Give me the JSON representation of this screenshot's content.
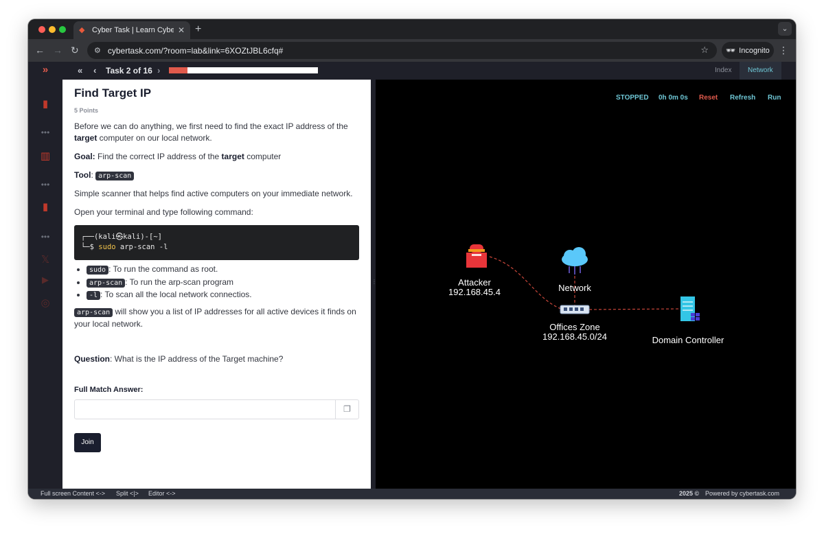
{
  "browser": {
    "tab_title": "Cyber Task | Learn Cybersecurity",
    "tab_close": "✕",
    "new_tab": "+",
    "url": "cybertask.com/?room=lab&link=6XOZtJBL6cfq#",
    "profile_label": "Incognito"
  },
  "topbar": {
    "task_label": "Task 2 of 16",
    "progress_fraction": 0.125,
    "index_label": "Index",
    "network_label": "Network"
  },
  "task": {
    "title": "Find Target IP",
    "points": "5 Points",
    "intro_1": "Before we can do anything, we first need to find the exact IP address of the ",
    "intro_bold": "target",
    "intro_2": " computer on our local network.",
    "goal_label": "Goal:",
    "goal_1": " Find the correct IP address of the ",
    "goal_bold": "target",
    "goal_2": " computer",
    "tool_label": "Tool",
    "tool_sep": ": ",
    "tool_name": "arp-scan",
    "tool_desc": "Simple scanner that helps find active computers on your immediate network.",
    "terminal_intro": "Open your terminal and type following command:",
    "terminal_line1": "┌──(kali㉿kali)-[~]",
    "terminal_prompt": "└─$ ",
    "terminal_sudo": "sudo",
    "terminal_cmd": " arp-scan -l",
    "options": [
      {
        "code": "sudo",
        "desc": ": To run the command as root."
      },
      {
        "code": "arp-scan",
        "desc": ": To run the arp-scan program"
      },
      {
        "code": "-l",
        "desc": ": To scan all the local network connectios."
      }
    ],
    "result_code": "arp-scan",
    "result_desc": " will show you a list of IP addresses for all active devices it finds on your local network.",
    "question_label": "Question",
    "question_text": ": What is the IP address of the Target machine?",
    "answer_label": "Full Match Answer:",
    "answer_value": "",
    "join_label": "Join"
  },
  "network_panel": {
    "status": "STOPPED",
    "timer": "0h 0m 0s",
    "reset_label": "Reset",
    "refresh_label": "Refresh",
    "run_label": "Run",
    "nodes": {
      "attacker_name": "Attacker",
      "attacker_ip": "192.168.45.4",
      "network_name": "Network",
      "offices_name": "Offices Zone",
      "offices_ip": "192.168.45.0/24",
      "dc_name": "Domain Controller"
    },
    "colors": {
      "status": "#6fc7d6",
      "timer": "#6fc7d6",
      "reset": "#e05a4c",
      "refresh": "#6fc7d6",
      "run": "#6fc7d6",
      "link": "#c9463a"
    }
  },
  "footer": {
    "fullscreen": "Full screen Content <->",
    "split": "Split <|>",
    "editor": "Editor <->",
    "year": "2025 ©",
    "powered": "Powered by cybertask.com"
  },
  "icons": [
    "logo-chevron-icon",
    "door-icon",
    "books-icon",
    "bookmark-icon",
    "x-icon",
    "youtube-icon",
    "instagram-icon",
    "copy-icon",
    "attacker-icon",
    "cloud-icon",
    "switch-icon",
    "server-icon"
  ]
}
